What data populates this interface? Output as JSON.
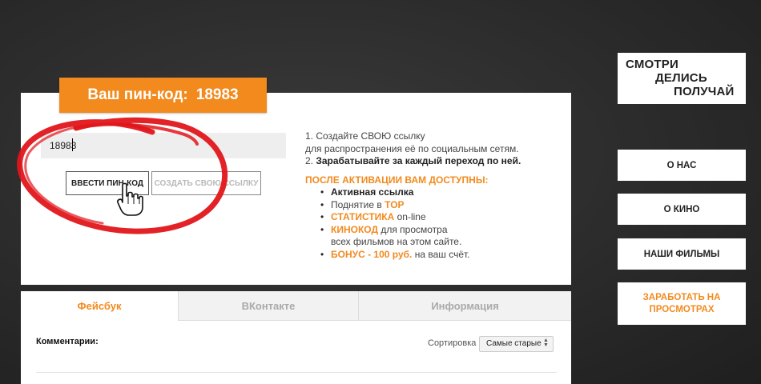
{
  "pin": {
    "badge_label": "Ваш пин-код:",
    "badge_code": "18983",
    "input_value": "18983",
    "enter_button": "ВВЕСТИ ПИН-КОД",
    "create_button": "СОЗДАТЬ СВОЮ ССЫЛКУ"
  },
  "info": {
    "step1_line1": "1. Создайте СВОЮ ссылку",
    "step1_line2": "для распространения её по социальным сетям.",
    "step2_prefix": "2. ",
    "step2_bold": "Зарабатывайте за каждый переход по ней.",
    "after_header": "ПОСЛЕ АКТИВАЦИИ ВАМ ДОСТУПНЫ:",
    "items": {
      "active_link": "Активная ссылка",
      "top_prefix": "Поднятие в ",
      "top_word": "TOP",
      "stats_word": "СТАТИСТИКА",
      "stats_suffix": " on-line",
      "kinocode_word": "КИНОКОД",
      "kinocode_line1": " для просмотра",
      "kinocode_line2": "всех фильмов на этом сайте.",
      "bonus_word": "БОНУС - 100 руб.",
      "bonus_suffix": " на ваш счёт."
    }
  },
  "comments": {
    "tabs": [
      "Фейсбук",
      "ВКонтакте",
      "Информация"
    ],
    "active_tab": "Фейсбук",
    "label": "Комментарии:",
    "sort_label": "Сортировка",
    "sort_value": "Самые старые"
  },
  "sidebar": {
    "logo": [
      "СМОТРИ",
      "ДЕЛИСЬ",
      "ПОЛУЧАЙ"
    ],
    "nav": {
      "about": "О НАС",
      "cinema": "О КИНО",
      "films": "НАШИ ФИЛЬМЫ",
      "earn_line1": "ЗАРАБОТАТЬ НА",
      "earn_line2": "ПРОСМОТРАХ"
    }
  },
  "colors": {
    "accent": "#f28a1e",
    "background": "#2b2b2b",
    "annotation": "#e0161b"
  },
  "icons": [
    "hand-pointer-icon",
    "sort-arrows-icon"
  ]
}
